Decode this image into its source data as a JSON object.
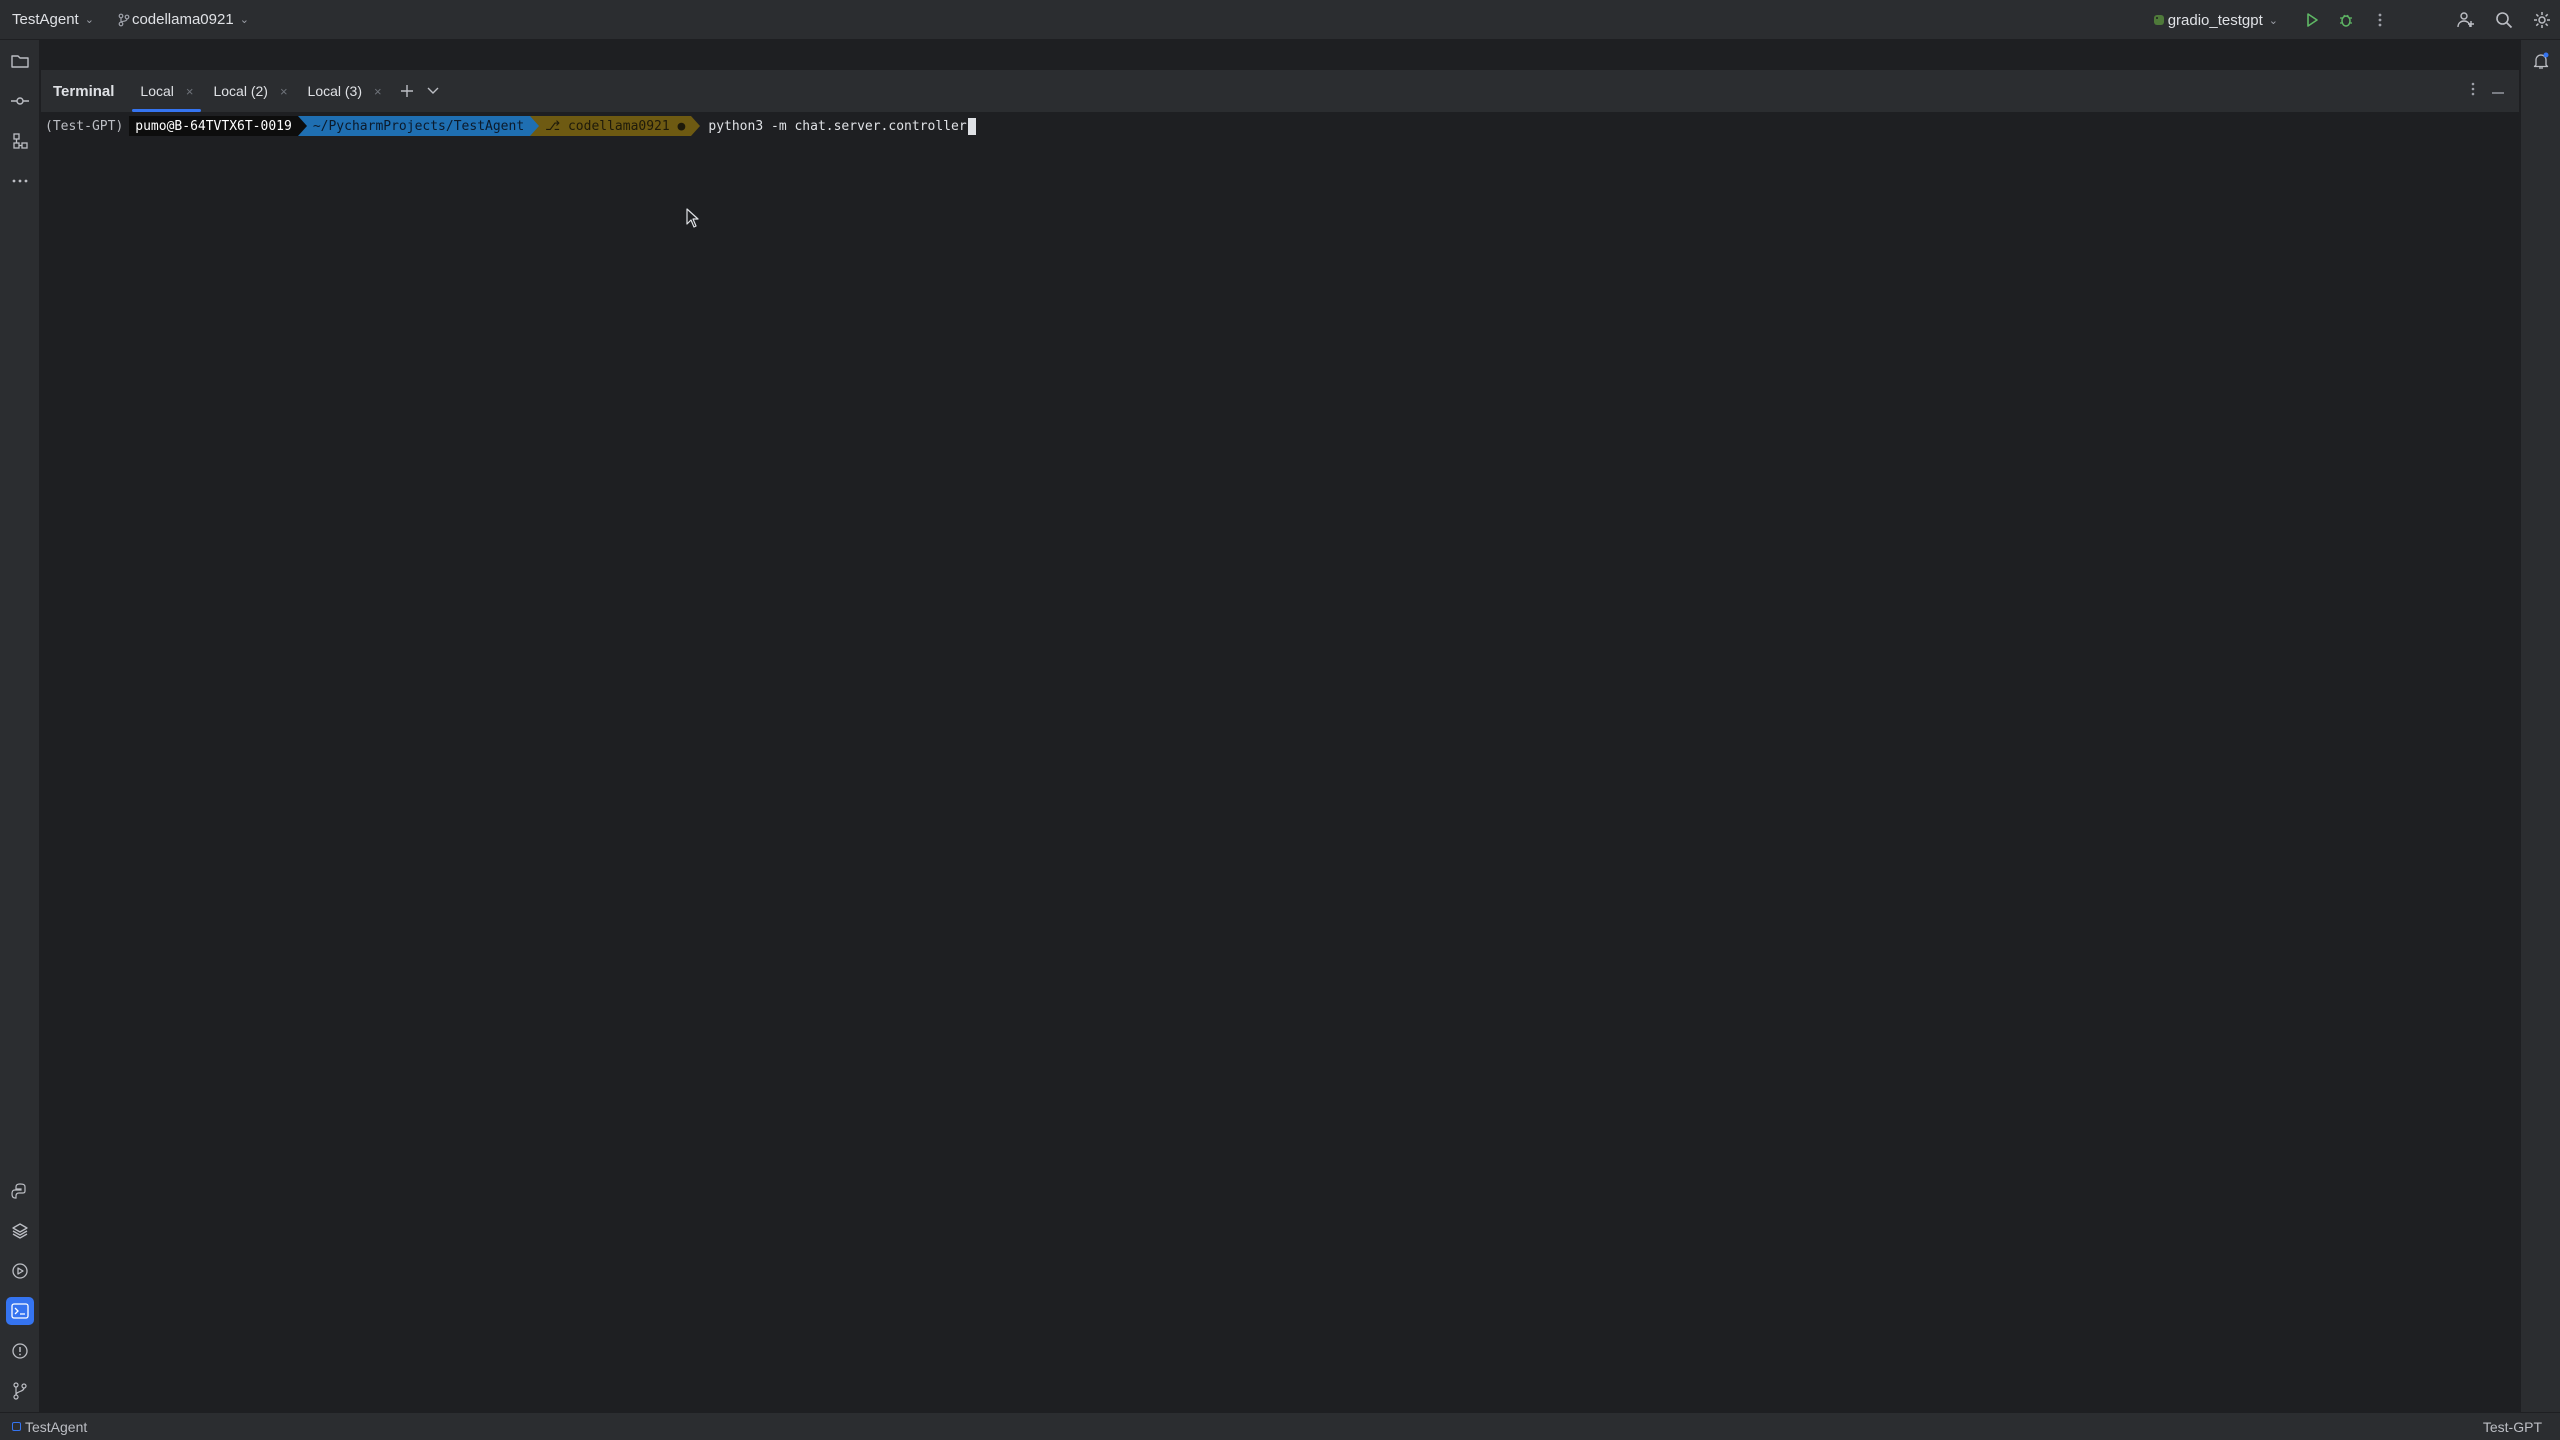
{
  "titlebar": {
    "project": "TestAgent",
    "branch": "codellama0921",
    "run_config": "gradio_testgpt"
  },
  "tool_window": {
    "title": "Terminal",
    "tabs": [
      {
        "label": "Local",
        "active": true
      },
      {
        "label": "Local (2)",
        "active": false
      },
      {
        "label": "Local (3)",
        "active": false
      }
    ]
  },
  "terminal": {
    "env": "(Test-GPT)",
    "user_host": "pumo@B-64TVTX6T-0019",
    "path": "~/PycharmProjects/TestAgent",
    "branch_segment": "⎇ codellama0921 ●",
    "command": "python3 -m chat.server.controller"
  },
  "statusbar": {
    "project": "TestAgent",
    "interpreter": "Test-GPT"
  },
  "colors": {
    "accent": "#3574f0",
    "path_segment": "#1f6fb2",
    "branch_segment": "#6e5a12",
    "run_green": "#5fb865"
  },
  "icons": {
    "left_top": [
      "folder-icon",
      "commit-icon",
      "structure-icon",
      "more-icon"
    ],
    "left_bottom": [
      "python-console-icon",
      "layers-icon",
      "services-icon",
      "terminal-icon",
      "problems-icon",
      "git-icon"
    ],
    "right": [
      "notifications-icon"
    ]
  }
}
